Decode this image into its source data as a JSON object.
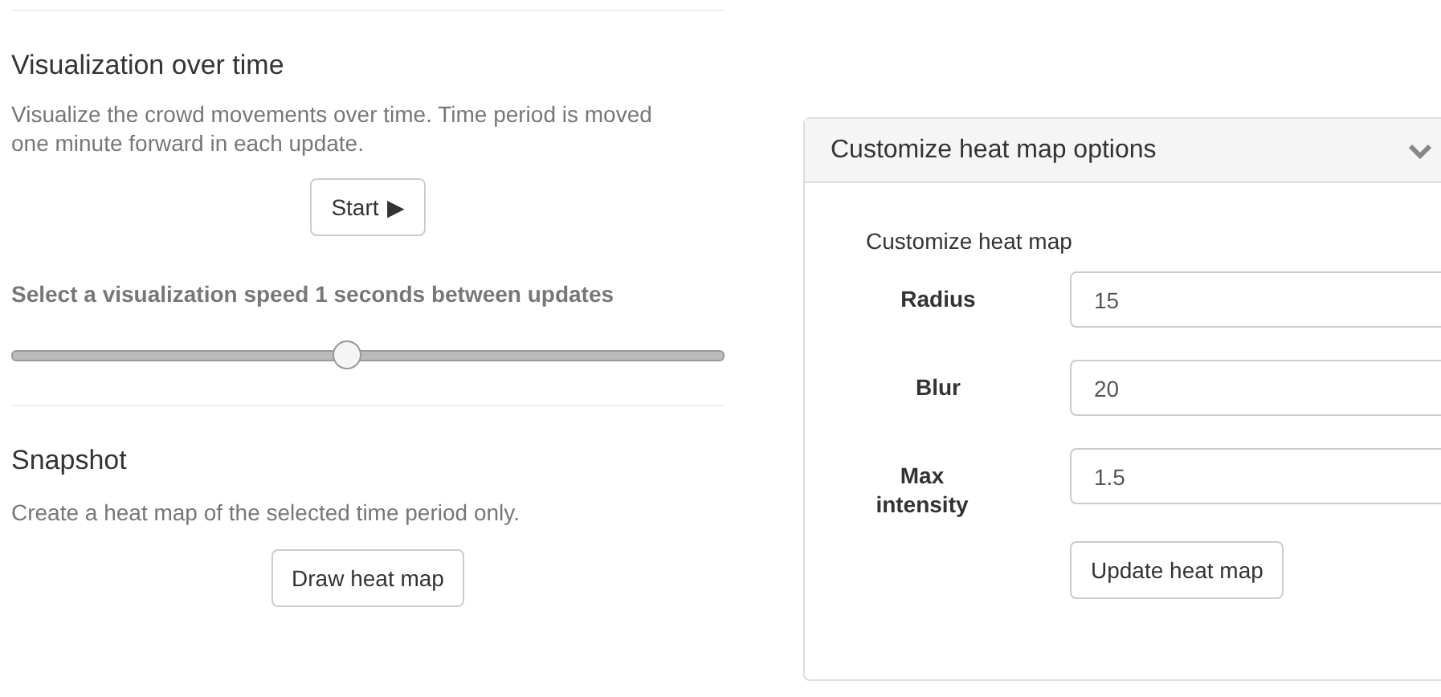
{
  "visualization": {
    "title": "Visualization over time",
    "description": "Visualize the crowd movements over time. Time period is moved one minute forward in each update.",
    "start_button": {
      "label": "Start",
      "icon": "▶"
    },
    "speed_label": "Select a visualization speed 1 seconds between updates",
    "speed_slider": {
      "level": 0.47
    }
  },
  "snapshot": {
    "title": "Snapshot",
    "description": "Create a heat map of the selected time period only.",
    "button": "Draw heat map"
  },
  "options_panel": {
    "title": "Customize heat map options",
    "expanded": true,
    "subtitle": "Customize heat map",
    "fields": [
      {
        "label": "Radius",
        "value": "15"
      },
      {
        "label": "Blur",
        "value": "20"
      },
      {
        "label": "Max intensity",
        "value": "1.5"
      }
    ],
    "button": "Update heat map"
  }
}
